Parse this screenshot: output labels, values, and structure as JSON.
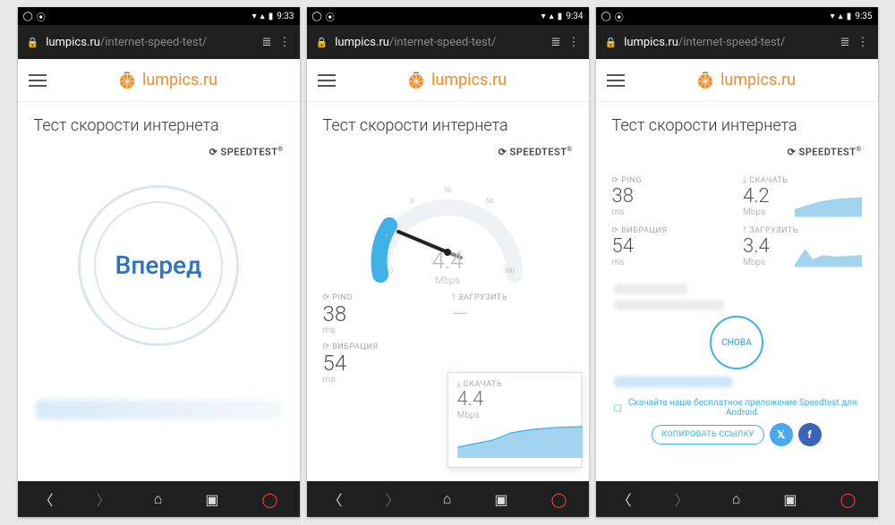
{
  "status": {
    "t1": "9:33",
    "t2": "9:34",
    "t3": "9:35"
  },
  "url": {
    "domain": "lumpics.ru",
    "path": "/internet-speed-test/"
  },
  "header": {
    "logo_text": "lumpics.ru"
  },
  "page_title": "Тест скорости интернета",
  "speedtest_badge": "SPEEDTEST",
  "screen1": {
    "go_label": "Вперед"
  },
  "screen2": {
    "gauge": {
      "value": "4.4",
      "unit": "Mbps",
      "ticks": [
        "0",
        "1",
        "5",
        "10",
        "50",
        "100"
      ]
    },
    "ping": {
      "label": "PING",
      "value": "38",
      "unit": "ms"
    },
    "jitter": {
      "label": "ВИБРАЦИЯ",
      "value": "54",
      "unit": "ms"
    },
    "download": {
      "label": "СКАЧАТЬ",
      "value": "4.4",
      "unit": "Mbps"
    },
    "upload": {
      "label": "ЗАГРУЗИТЬ",
      "value": "—"
    }
  },
  "screen3": {
    "ping": {
      "label": "PING",
      "value": "38",
      "unit": "ms"
    },
    "jitter": {
      "label": "ВИБРАЦИЯ",
      "value": "54",
      "unit": "ms"
    },
    "download": {
      "label": "СКАЧАТЬ",
      "value": "4.2",
      "unit": "Mbps"
    },
    "upload": {
      "label": "ЗАГРУЗИТЬ",
      "value": "3.4",
      "unit": "Mbps"
    },
    "again_label": "СНОВА",
    "promo": "Скачайте наше бесплатное приложение Speedtest для Android.",
    "copy_label": "КОПИРОВАТЬ ССЫЛКУ"
  }
}
